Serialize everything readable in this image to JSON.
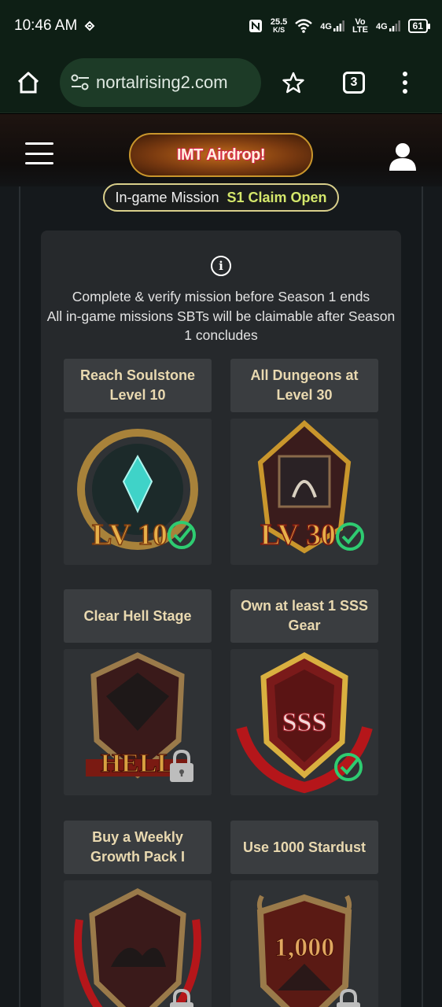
{
  "status_bar": {
    "time": "10:46 AM",
    "speed_value": "25.5",
    "speed_unit": "K/S",
    "net1": "4G",
    "net2_top": "Vo",
    "net2_bottom": "LTE",
    "net3": "4G",
    "battery": "61"
  },
  "browser": {
    "url": "nortalrising2.com",
    "tab_count": "3"
  },
  "header": {
    "airdrop_label": "IMT Airdrop!"
  },
  "mission_pill": {
    "label": "In-game Mission",
    "status": "S1 Claim Open"
  },
  "info": {
    "line1": "Complete & verify mission before Season 1 ends",
    "line2": "All in-game missions SBTs will be claimable after Season 1 concludes"
  },
  "missions": [
    {
      "title": "Reach Soulstone Level 10",
      "badge_text": "LV 10",
      "status": "completed",
      "icon": "check-icon"
    },
    {
      "title": "All Dungeons at Level 30",
      "badge_text": "LV 30",
      "status": "completed",
      "icon": "check-icon"
    },
    {
      "title": "Clear Hell Stage",
      "badge_text": "HELL",
      "status": "locked",
      "icon": "lock-icon"
    },
    {
      "title": "Own at least 1 SSS Gear",
      "badge_text": "SSS",
      "status": "completed",
      "icon": "check-icon"
    },
    {
      "title": "Buy a Weekly Growth Pack I",
      "badge_text": "",
      "status": "locked",
      "icon": "lock-icon"
    },
    {
      "title": "Use 1000 Stardust",
      "badge_text": "1,000",
      "status": "locked",
      "icon": "lock-icon"
    }
  ],
  "colors": {
    "accent_green": "#2ecc71",
    "claim_yellow": "#d4e76b",
    "gold": "#c9962c"
  }
}
